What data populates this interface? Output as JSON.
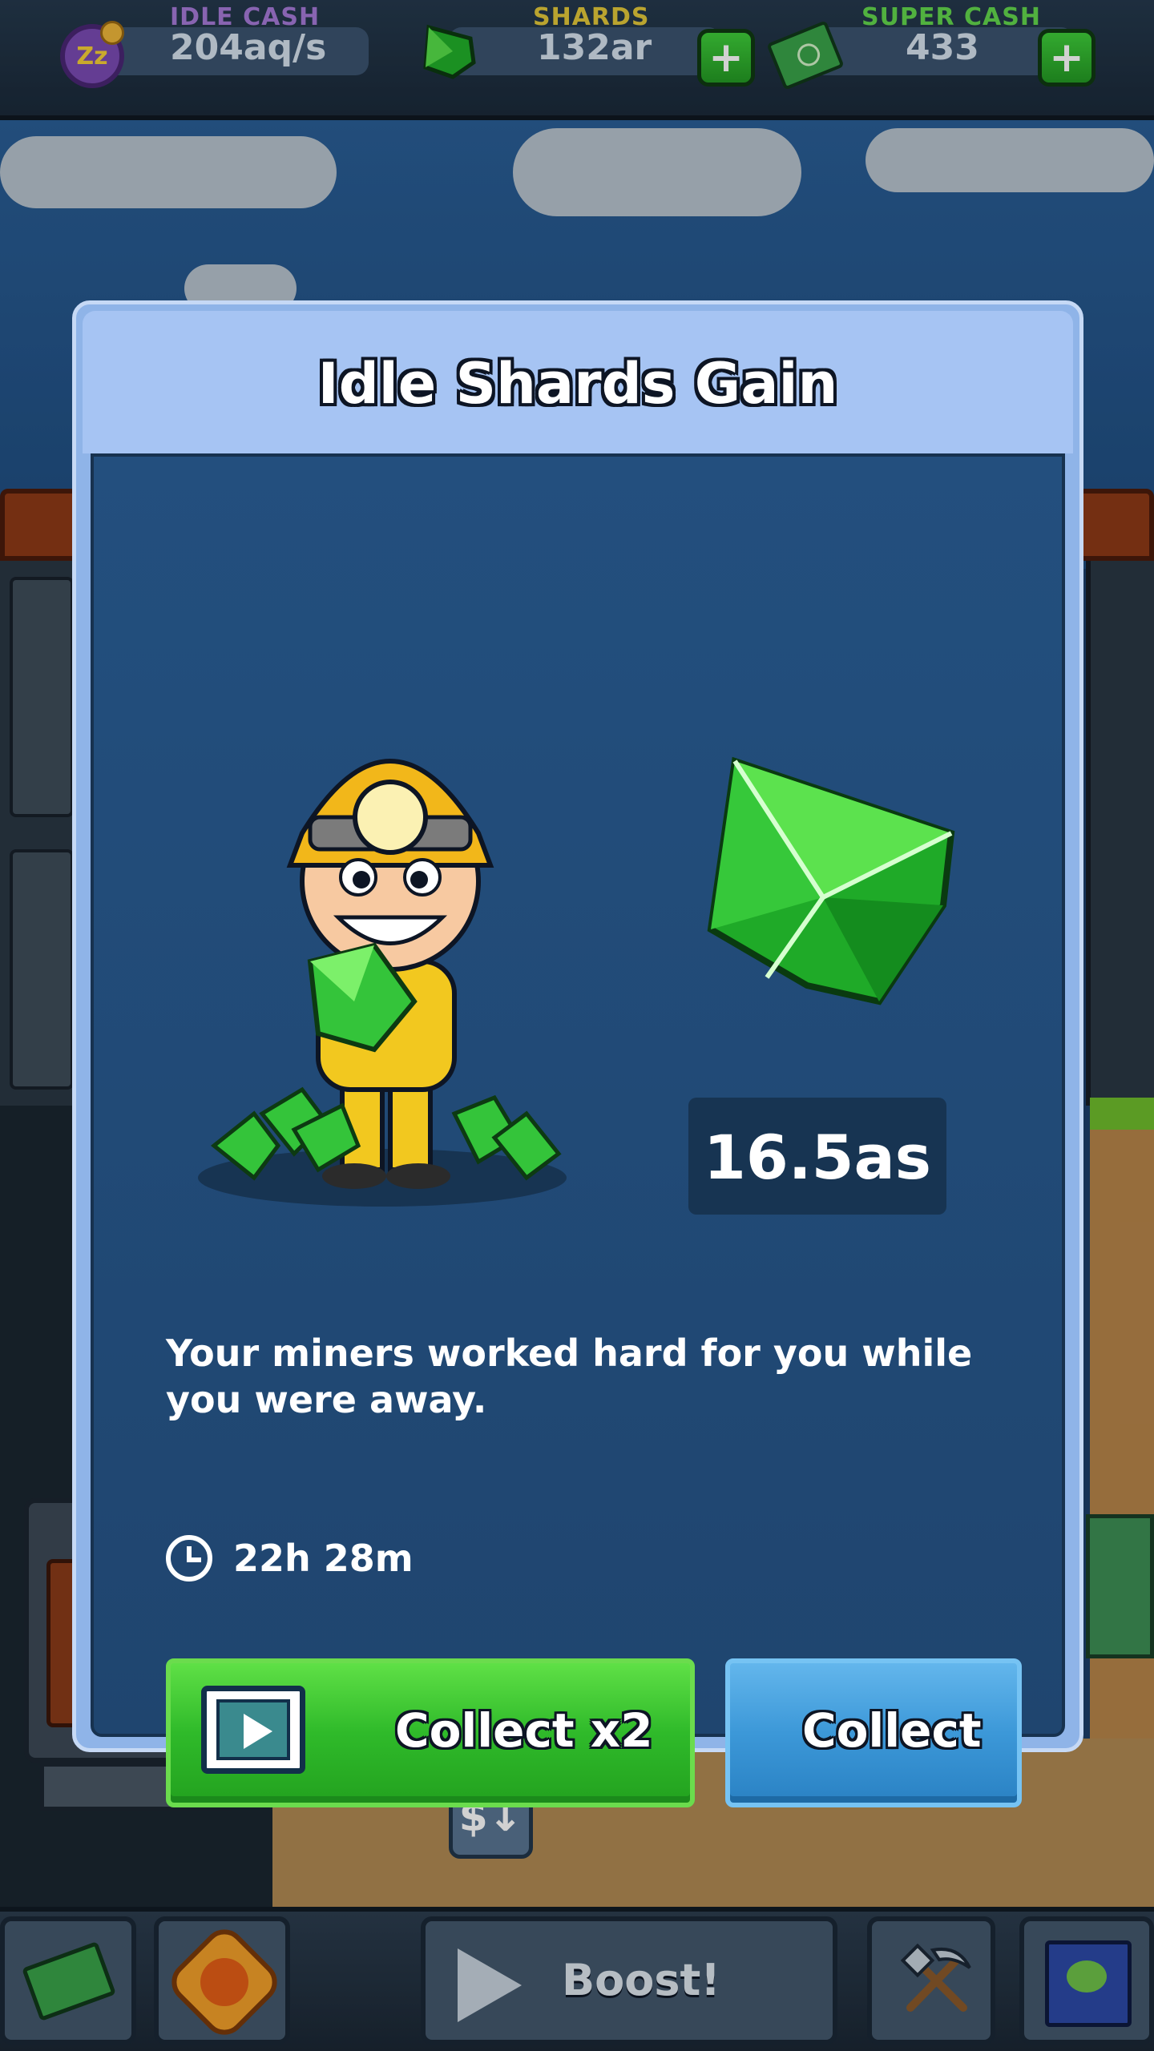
{
  "hud": {
    "idle_cash": {
      "label": "IDLE CASH",
      "value": "204aq/s",
      "icon": "zzz-coin-icon"
    },
    "shards": {
      "label": "SHARDS",
      "value": "132ar",
      "icon": "green-shard-icon"
    },
    "super_cash": {
      "label": "SUPER CASH",
      "value": "433",
      "icon": "cash-bundle-icon"
    },
    "plus_label": "+",
    "colors": {
      "idle_label": "#a77bd8",
      "shards_label": "#e3c93a",
      "super_label": "#63d84e"
    }
  },
  "dialog": {
    "title": "Idle Shards Gain",
    "amount": "16.5as",
    "message": "Your miners worked hard for you while you were away.",
    "time_away": "22h 28m",
    "buttons": {
      "collect_x2": "Collect x2",
      "collect": "Collect"
    },
    "colors": {
      "primary_green": "#2fba2a",
      "secondary_blue": "#3c98d8",
      "body": "#234f7e"
    }
  },
  "scene": {
    "withdraw_sign": "$↓"
  },
  "bottom_bar": {
    "boost_label": "Boost!",
    "items": [
      "cash-shop-icon",
      "bolt-badge-icon",
      "play-icon",
      "pickaxe-shovel-icon",
      "world-map-icon"
    ]
  }
}
